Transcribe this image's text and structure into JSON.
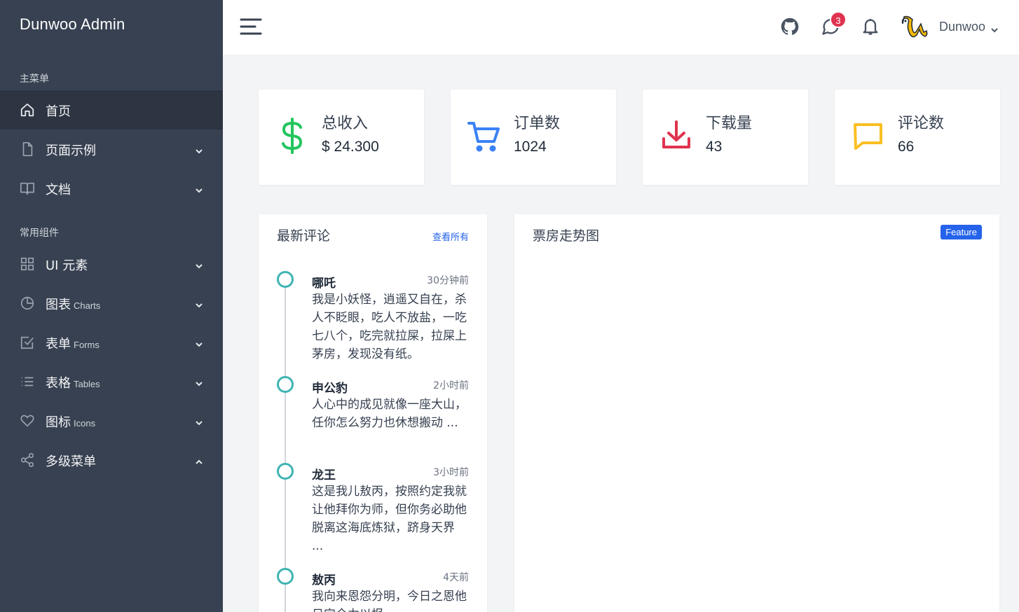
{
  "sidebar": {
    "brand": "Dunwoo Admin",
    "section_main": "主菜单",
    "section_components": "常用组件",
    "items": [
      {
        "label": "首页",
        "sub": ""
      },
      {
        "label": "页面示例",
        "sub": ""
      },
      {
        "label": "文档",
        "sub": ""
      },
      {
        "label": "UI 元素",
        "sub": ""
      },
      {
        "label": "图表",
        "sub": "Charts"
      },
      {
        "label": "表单",
        "sub": "Forms"
      },
      {
        "label": "表格",
        "sub": "Tables"
      },
      {
        "label": "图标",
        "sub": "Icons"
      },
      {
        "label": "多级菜单",
        "sub": ""
      }
    ]
  },
  "header": {
    "notification_count": "3",
    "user_name": "Dunwoo"
  },
  "stats": [
    {
      "title": "总收入",
      "value": "$ 24.300",
      "icon": "dollar-icon",
      "color": "#22c55e"
    },
    {
      "title": "订单数",
      "value": "1024",
      "icon": "cart-icon",
      "color": "#3b82f6"
    },
    {
      "title": "下载量",
      "value": "43",
      "icon": "download-icon",
      "color": "#e0334f"
    },
    {
      "title": "评论数",
      "value": "66",
      "icon": "comment-icon",
      "color": "#fbbf24"
    }
  ],
  "comments": {
    "title": "最新评论",
    "view_all": "查看所有",
    "items": [
      {
        "name": "哪吒",
        "time": "30分钟前",
        "text": "我是小妖怪，逍遥又自在，杀人不眨眼，吃人不放盐，一吃七八个，吃完就拉屎，拉屎上茅房，发现没有纸。"
      },
      {
        "name": "申公豹",
        "time": "2小时前",
        "text": "人心中的成见就像一座大山，任你怎么努力也休想搬动 ..."
      },
      {
        "name": "龙王",
        "time": "3小时前",
        "text": "这是我儿敖丙，按照约定我就让他拜你为师，但你务必助他脱离这海底炼狱，跻身天界 ..."
      },
      {
        "name": "敖丙",
        "time": "4天前",
        "text": "我向来恩怨分明，今日之恩他日定全力以报"
      }
    ]
  },
  "chart_panel": {
    "title": "票房走势图",
    "badge": "Feature"
  },
  "colors": {
    "sidebar_bg": "#374151",
    "accent": "#2563eb",
    "timeline_dot": "#3fb3b3",
    "badge": "#e0334f"
  }
}
